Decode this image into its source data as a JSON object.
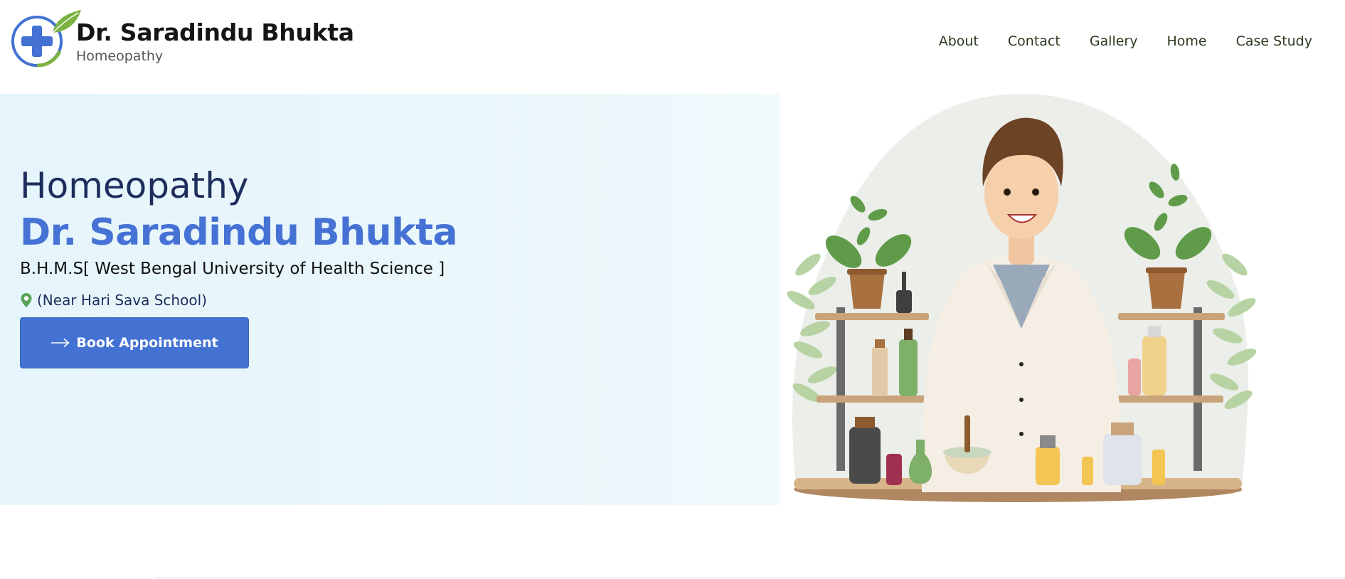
{
  "brand": {
    "name": "Dr. Saradindu Bhukta",
    "subtitle": "Homeopathy",
    "logo_icon": "medical-cross-leaf-icon"
  },
  "nav": {
    "items": [
      {
        "label": "About"
      },
      {
        "label": "Contact"
      },
      {
        "label": "Gallery"
      },
      {
        "label": "Home"
      },
      {
        "label": "Case Study"
      }
    ]
  },
  "hero": {
    "title": "Homeopathy",
    "name": "Dr. Saradindu Bhukta",
    "degree": "B.H.M.S[ West Bengal University of Health Science ]",
    "location": "(Near Hari Sava School)",
    "location_icon": "map-pin-icon",
    "button_label": "Book Appointment",
    "button_icon": "arrow-right-icon",
    "illustration": "doctor-with-herbal-shelves-illustration"
  },
  "colors": {
    "primary": "#4372d3",
    "heading": "#1d2d5c",
    "hero_bg": "#e6f5fb",
    "leaf_green": "#6aa84f"
  }
}
